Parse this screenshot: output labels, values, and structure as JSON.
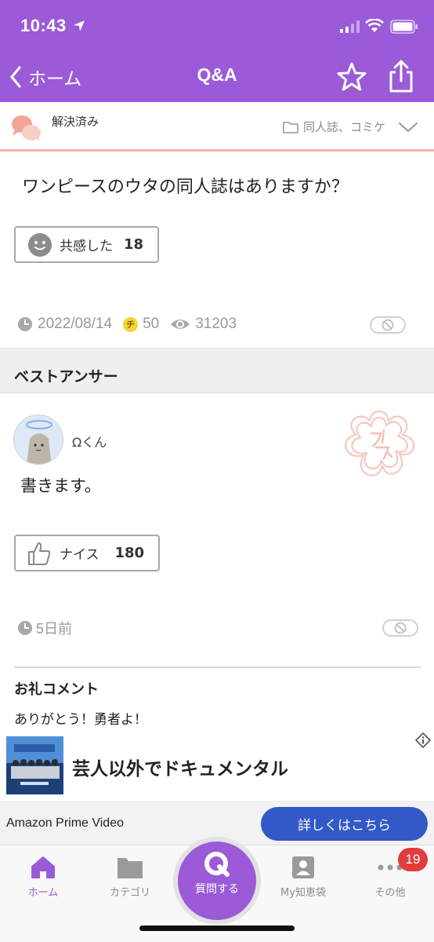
{
  "status": {
    "time": "10:43"
  },
  "nav": {
    "back_label": "ホーム",
    "title": "Q&A"
  },
  "question": {
    "status": "解決済み",
    "category": "同人誌、コミケ",
    "text": "ワンピースのウタの同人誌はありますか？",
    "empathy_label": "共感した",
    "empathy_count": "18",
    "date": "2022/08/14",
    "coin_symbol": "チ",
    "coins": "50",
    "views": "31203"
  },
  "best_answer": {
    "section_title": "ベストアンサー",
    "username": "Ωくん",
    "text": "書きます。",
    "nice_label": "ナイス",
    "nice_count": "180",
    "time": "5日前",
    "thanks_title": "お礼コメント",
    "thanks_text": "ありがとう！勇者よ！"
  },
  "ad": {
    "headline": "芸人以外でドキュメンタル",
    "advertiser": "Amazon Prime Video",
    "cta": "詳しくはこちら"
  },
  "tabbar": {
    "home": "ホーム",
    "category": "カテゴリ",
    "ask_icon": "Q",
    "ask": "質問する",
    "my": "My知恵袋",
    "more": "その他",
    "badge": "19"
  },
  "colors": {
    "brand": "#9b5ad8",
    "cta": "#3359c7",
    "badge": "#e23c3c",
    "accent_line": "#f0b4a8"
  }
}
